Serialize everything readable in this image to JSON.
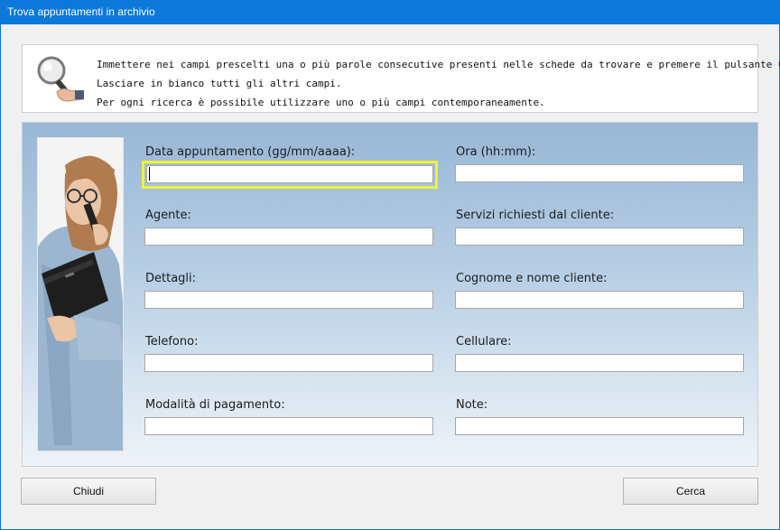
{
  "window": {
    "title": "Trova appuntamenti in archivio"
  },
  "info": {
    "icon": "magnifier-icon",
    "lines": [
      "Immettere nei campi prescelti una o più parole consecutive presenti nelle schede da trovare e premere il pulsante Cerca.",
      "Lasciare in bianco tutti gli altri campi.",
      "Per ogni ricerca è possibile utilizzare uno o più campi contemporaneamente."
    ]
  },
  "form": {
    "fields": {
      "data_appuntamento": {
        "label": "Data appuntamento (gg/mm/aaaa):",
        "value": ""
      },
      "ora": {
        "label": "Ora (hh:mm):",
        "value": ""
      },
      "agente": {
        "label": "Agente:",
        "value": ""
      },
      "servizi": {
        "label": "Servizi richiesti dal cliente:",
        "value": ""
      },
      "dettagli": {
        "label": "Dettagli:",
        "value": ""
      },
      "cognome_nome": {
        "label": "Cognome e nome cliente:",
        "value": ""
      },
      "telefono": {
        "label": "Telefono:",
        "value": ""
      },
      "cellulare": {
        "label": "Cellulare:",
        "value": ""
      },
      "pagamento": {
        "label": "Modalità di pagamento:",
        "value": ""
      },
      "note": {
        "label": "Note:",
        "value": ""
      }
    }
  },
  "buttons": {
    "close": "Chiudi",
    "search": "Cerca"
  },
  "colors": {
    "titlebar": "#0b78da",
    "focus": "#f3f330",
    "panel_top": "#98b7d6",
    "panel_bottom": "#eef3f8"
  }
}
